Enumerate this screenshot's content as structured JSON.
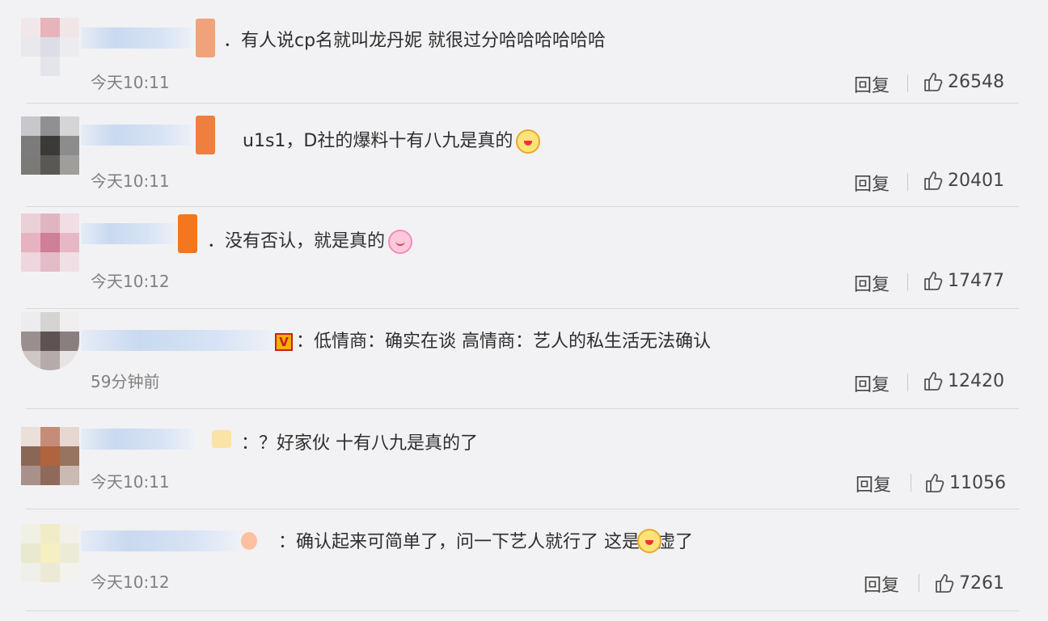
{
  "comments": [
    {
      "text": "．有人说cp名就叫龙丹妮 就很过分哈哈哈哈哈哈",
      "time": "今天10:11",
      "reply_label": "回复",
      "likes": "26548",
      "avatar_colors": [
        "#f1e7ea",
        "#e8b4bb",
        "#f0e6e8",
        "#e9e9ed",
        "#dcdde6",
        "#ececf0",
        "#f2f2f5",
        "#e4e5ea",
        "#f2f2f5"
      ],
      "badge_color": "#f0a37a",
      "emoji": ""
    },
    {
      "text": "u1s1，D社的爆料十有八九是真的",
      "time": "今天10:11",
      "reply_label": "回复",
      "likes": "20401",
      "avatar_colors": [
        "#c8c8cc",
        "#909092",
        "#d5d5d8",
        "#7b7b7c",
        "#3b3a38",
        "#8c8c8d",
        "#7c7a76",
        "#5a5854",
        "#a09e9b"
      ],
      "badge_color": "#f07e3d",
      "emoji": "fox-emoji"
    },
    {
      "text": "．没有否认，就是真的",
      "time": "今天10:12",
      "reply_label": "回复",
      "likes": "17477",
      "avatar_colors": [
        "#ecd0d8",
        "#e0b5c2",
        "#f1dde3",
        "#e7b3c1",
        "#cf7f97",
        "#e6b8c5",
        "#efd5dd",
        "#e3bcc8",
        "#f0e0e6"
      ],
      "badge_color": "#f2771f",
      "emoji": "bunny-emoji"
    },
    {
      "prefix_badge": "V",
      "text": "：低情商：确实在谈 高情商：艺人的私生活无法确认",
      "time": "59分钟前",
      "reply_label": "回复",
      "likes": "12420",
      "avatar_colors": [
        "#ececee",
        "#d6d3d3",
        "#f0eeee",
        "#9a8f8f",
        "#5e5252",
        "#8a7f7f",
        "#cfc6c6",
        "#b5abab",
        "#e8e4e4"
      ],
      "badge_color": "#e9c0c0",
      "emoji": ""
    },
    {
      "text": "：？好家伙 十有八九是真的了",
      "time": "今天10:11",
      "reply_label": "回复",
      "likes": "11056",
      "avatar_colors": [
        "#eadfd9",
        "#c58d78",
        "#e7d7d1",
        "#8a6654",
        "#b0633f",
        "#96745f",
        "#a8918a",
        "#8f6a5a",
        "#cbb9b3"
      ],
      "badge_color": "#fbe3a6",
      "emoji": ""
    },
    {
      "text": "：确认起来可简单了，问一下艺人就行了 这是心虚了",
      "time": "今天10:12",
      "reply_label": "回复",
      "likes": "7261",
      "avatar_colors": [
        "#f1f0e5",
        "#f1ecc8",
        "#f3f1e7",
        "#e9e9cf",
        "#f5efc2",
        "#ecebd8",
        "#f0f0ea",
        "#ece9d6",
        "#f3f2ec"
      ],
      "badge_color": "#ffbfa1",
      "emoji": "fox-emoji"
    }
  ]
}
